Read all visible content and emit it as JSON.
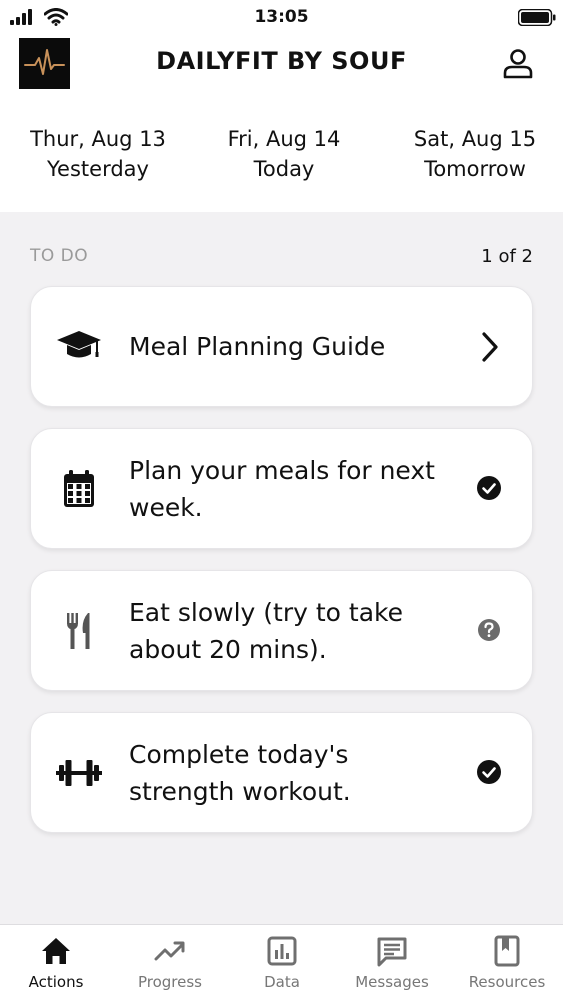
{
  "status_bar": {
    "time": "13:05",
    "signal_icon": "cellular-signal-icon",
    "wifi_icon": "wifi-icon",
    "battery_icon": "battery-icon"
  },
  "header": {
    "title": "DAILYFIT BY SOUF",
    "logo_icon": "heartbeat-logo-icon",
    "profile_icon": "user-profile-icon",
    "logo_color": "#c8915a"
  },
  "days": [
    {
      "date": "Thur, Aug 13",
      "relative": "Yesterday"
    },
    {
      "date": "Fri, Aug 14",
      "relative": "Today"
    },
    {
      "date": "Sat, Aug 15",
      "relative": "Tomorrow"
    }
  ],
  "todo": {
    "label": "TO DO",
    "count": "1 of 2",
    "items": [
      {
        "text": "Meal Planning Guide",
        "icon": "graduation-cap-icon",
        "status_icon": "chevron-right-icon"
      },
      {
        "text": "Plan your meals for next week.",
        "icon": "calendar-icon",
        "status_icon": "check-circle-icon"
      },
      {
        "text": "Eat slowly (try to take about 20 mins).",
        "icon": "fork-knife-icon",
        "status_icon": "question-circle-icon"
      },
      {
        "text": "Complete today's strength workout.",
        "icon": "dumbbell-icon",
        "status_icon": "check-circle-icon"
      }
    ]
  },
  "nav": {
    "items": [
      {
        "label": "Actions",
        "icon": "home-icon",
        "active": true
      },
      {
        "label": "Progress",
        "icon": "trending-up-icon",
        "active": false
      },
      {
        "label": "Data",
        "icon": "bar-chart-icon",
        "active": false
      },
      {
        "label": "Messages",
        "icon": "message-icon",
        "active": false
      },
      {
        "label": "Resources",
        "icon": "bookmark-book-icon",
        "active": false
      }
    ]
  },
  "colors": {
    "background": "#f2f1f3",
    "card": "#ffffff",
    "text": "#111111",
    "muted": "#9a9a9a",
    "question_icon": "#6b6b6b"
  }
}
